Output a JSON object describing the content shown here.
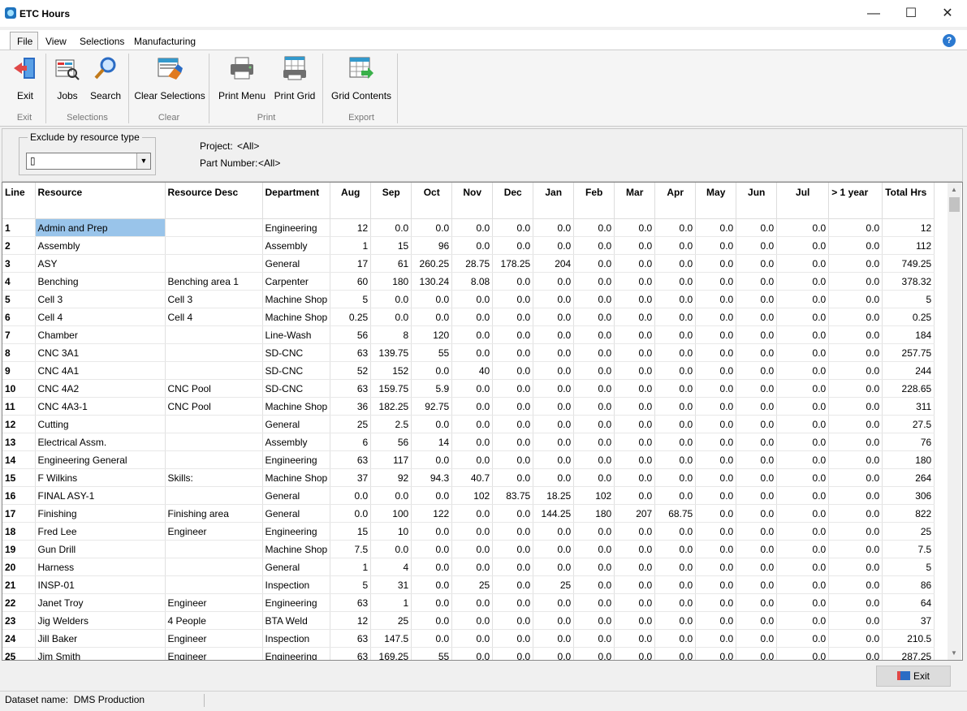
{
  "window": {
    "title": "ETC Hours"
  },
  "menu": {
    "items": [
      "File",
      "View",
      "Selections",
      "Manufacturing"
    ]
  },
  "ribbon": {
    "buttons": {
      "exit": "Exit",
      "jobs": "Jobs",
      "search": "Search",
      "clear_selections": "Clear Selections",
      "print_menu": "Print Menu",
      "print_grid": "Print Grid",
      "grid_contents": "Grid Contents"
    },
    "groups": {
      "exit": "Exit",
      "selections": "Selections",
      "clear": "Clear",
      "print": "Print",
      "export": "Export"
    }
  },
  "filter": {
    "exclude_legend": "Exclude by resource type",
    "exclude_value": "▯",
    "project_label": "Project:",
    "project_value": "<All>",
    "part_label": "Part Number:",
    "part_value": "<All>"
  },
  "grid": {
    "columns": [
      "Line",
      "Resource",
      "Resource Desc",
      "Department",
      "Aug",
      "Sep",
      "Oct",
      "Nov",
      "Dec",
      "Jan",
      "Feb",
      "Mar",
      "Apr",
      "May",
      "Jun",
      "Jul",
      "> 1 year",
      "Total Hrs"
    ],
    "rows": [
      [
        "1",
        "Admin and Prep",
        "",
        "Engineering",
        "12",
        "0.0",
        "0.0",
        "0.0",
        "0.0",
        "0.0",
        "0.0",
        "0.0",
        "0.0",
        "0.0",
        "0.0",
        "0.0",
        "0.0",
        "12"
      ],
      [
        "2",
        "Assembly",
        "",
        "Assembly",
        "1",
        "15",
        "96",
        "0.0",
        "0.0",
        "0.0",
        "0.0",
        "0.0",
        "0.0",
        "0.0",
        "0.0",
        "0.0",
        "0.0",
        "112"
      ],
      [
        "3",
        "ASY",
        "",
        "General",
        "17",
        "61",
        "260.25",
        "28.75",
        "178.25",
        "204",
        "0.0",
        "0.0",
        "0.0",
        "0.0",
        "0.0",
        "0.0",
        "0.0",
        "749.25"
      ],
      [
        "4",
        "Benching",
        "Benching area 1",
        "Carpenter",
        "60",
        "180",
        "130.24",
        "8.08",
        "0.0",
        "0.0",
        "0.0",
        "0.0",
        "0.0",
        "0.0",
        "0.0",
        "0.0",
        "0.0",
        "378.32"
      ],
      [
        "5",
        "Cell 3",
        "Cell 3",
        "Machine Shop",
        "5",
        "0.0",
        "0.0",
        "0.0",
        "0.0",
        "0.0",
        "0.0",
        "0.0",
        "0.0",
        "0.0",
        "0.0",
        "0.0",
        "0.0",
        "5"
      ],
      [
        "6",
        "Cell 4",
        "Cell 4",
        "Machine Shop",
        "0.25",
        "0.0",
        "0.0",
        "0.0",
        "0.0",
        "0.0",
        "0.0",
        "0.0",
        "0.0",
        "0.0",
        "0.0",
        "0.0",
        "0.0",
        "0.25"
      ],
      [
        "7",
        "Chamber",
        "",
        "Line-Wash",
        "56",
        "8",
        "120",
        "0.0",
        "0.0",
        "0.0",
        "0.0",
        "0.0",
        "0.0",
        "0.0",
        "0.0",
        "0.0",
        "0.0",
        "184"
      ],
      [
        "8",
        "CNC 3A1",
        "",
        "SD-CNC",
        "63",
        "139.75",
        "55",
        "0.0",
        "0.0",
        "0.0",
        "0.0",
        "0.0",
        "0.0",
        "0.0",
        "0.0",
        "0.0",
        "0.0",
        "257.75"
      ],
      [
        "9",
        "CNC 4A1",
        "",
        "SD-CNC",
        "52",
        "152",
        "0.0",
        "40",
        "0.0",
        "0.0",
        "0.0",
        "0.0",
        "0.0",
        "0.0",
        "0.0",
        "0.0",
        "0.0",
        "244"
      ],
      [
        "10",
        "CNC 4A2",
        "CNC Pool",
        "SD-CNC",
        "63",
        "159.75",
        "5.9",
        "0.0",
        "0.0",
        "0.0",
        "0.0",
        "0.0",
        "0.0",
        "0.0",
        "0.0",
        "0.0",
        "0.0",
        "228.65"
      ],
      [
        "11",
        "CNC 4A3-1",
        "CNC Pool",
        "Machine Shop",
        "36",
        "182.25",
        "92.75",
        "0.0",
        "0.0",
        "0.0",
        "0.0",
        "0.0",
        "0.0",
        "0.0",
        "0.0",
        "0.0",
        "0.0",
        "311"
      ],
      [
        "12",
        "Cutting",
        "",
        "General",
        "25",
        "2.5",
        "0.0",
        "0.0",
        "0.0",
        "0.0",
        "0.0",
        "0.0",
        "0.0",
        "0.0",
        "0.0",
        "0.0",
        "0.0",
        "27.5"
      ],
      [
        "13",
        "Electrical Assm.",
        "",
        "Assembly",
        "6",
        "56",
        "14",
        "0.0",
        "0.0",
        "0.0",
        "0.0",
        "0.0",
        "0.0",
        "0.0",
        "0.0",
        "0.0",
        "0.0",
        "76"
      ],
      [
        "14",
        "Engineering General",
        "",
        "Engineering",
        "63",
        "117",
        "0.0",
        "0.0",
        "0.0",
        "0.0",
        "0.0",
        "0.0",
        "0.0",
        "0.0",
        "0.0",
        "0.0",
        "0.0",
        "180"
      ],
      [
        "15",
        "F Wilkins",
        "Skills:",
        "Machine Shop",
        "37",
        "92",
        "94.3",
        "40.7",
        "0.0",
        "0.0",
        "0.0",
        "0.0",
        "0.0",
        "0.0",
        "0.0",
        "0.0",
        "0.0",
        "264"
      ],
      [
        "16",
        "FINAL ASY-1",
        "",
        "General",
        "0.0",
        "0.0",
        "0.0",
        "102",
        "83.75",
        "18.25",
        "102",
        "0.0",
        "0.0",
        "0.0",
        "0.0",
        "0.0",
        "0.0",
        "306"
      ],
      [
        "17",
        "Finishing",
        "Finishing area",
        "General",
        "0.0",
        "100",
        "122",
        "0.0",
        "0.0",
        "144.25",
        "180",
        "207",
        "68.75",
        "0.0",
        "0.0",
        "0.0",
        "0.0",
        "822"
      ],
      [
        "18",
        "Fred Lee",
        "Engineer",
        "Engineering",
        "15",
        "10",
        "0.0",
        "0.0",
        "0.0",
        "0.0",
        "0.0",
        "0.0",
        "0.0",
        "0.0",
        "0.0",
        "0.0",
        "0.0",
        "25"
      ],
      [
        "19",
        "Gun Drill",
        "",
        "Machine Shop",
        "7.5",
        "0.0",
        "0.0",
        "0.0",
        "0.0",
        "0.0",
        "0.0",
        "0.0",
        "0.0",
        "0.0",
        "0.0",
        "0.0",
        "0.0",
        "7.5"
      ],
      [
        "20",
        "Harness",
        "",
        "General",
        "1",
        "4",
        "0.0",
        "0.0",
        "0.0",
        "0.0",
        "0.0",
        "0.0",
        "0.0",
        "0.0",
        "0.0",
        "0.0",
        "0.0",
        "5"
      ],
      [
        "21",
        "INSP-01",
        "",
        "Inspection",
        "5",
        "31",
        "0.0",
        "25",
        "0.0",
        "25",
        "0.0",
        "0.0",
        "0.0",
        "0.0",
        "0.0",
        "0.0",
        "0.0",
        "86"
      ],
      [
        "22",
        "Janet Troy",
        "Engineer",
        "Engineering",
        "63",
        "1",
        "0.0",
        "0.0",
        "0.0",
        "0.0",
        "0.0",
        "0.0",
        "0.0",
        "0.0",
        "0.0",
        "0.0",
        "0.0",
        "64"
      ],
      [
        "23",
        "Jig Welders",
        "4 People",
        "BTA Weld",
        "12",
        "25",
        "0.0",
        "0.0",
        "0.0",
        "0.0",
        "0.0",
        "0.0",
        "0.0",
        "0.0",
        "0.0",
        "0.0",
        "0.0",
        "37"
      ],
      [
        "24",
        "Jill Baker",
        "Engineer",
        "Inspection",
        "63",
        "147.5",
        "0.0",
        "0.0",
        "0.0",
        "0.0",
        "0.0",
        "0.0",
        "0.0",
        "0.0",
        "0.0",
        "0.0",
        "0.0",
        "210.5"
      ],
      [
        "25",
        "Jim Smith",
        "Engineer",
        "Engineering",
        "63",
        "169.25",
        "55",
        "0.0",
        "0.0",
        "0.0",
        "0.0",
        "0.0",
        "0.0",
        "0.0",
        "0.0",
        "0.0",
        "0.0",
        "287.25"
      ]
    ]
  },
  "footer": {
    "exit_label": "Exit"
  },
  "status": {
    "dataset_label": "Dataset name:",
    "dataset_value": "DMS Production"
  }
}
